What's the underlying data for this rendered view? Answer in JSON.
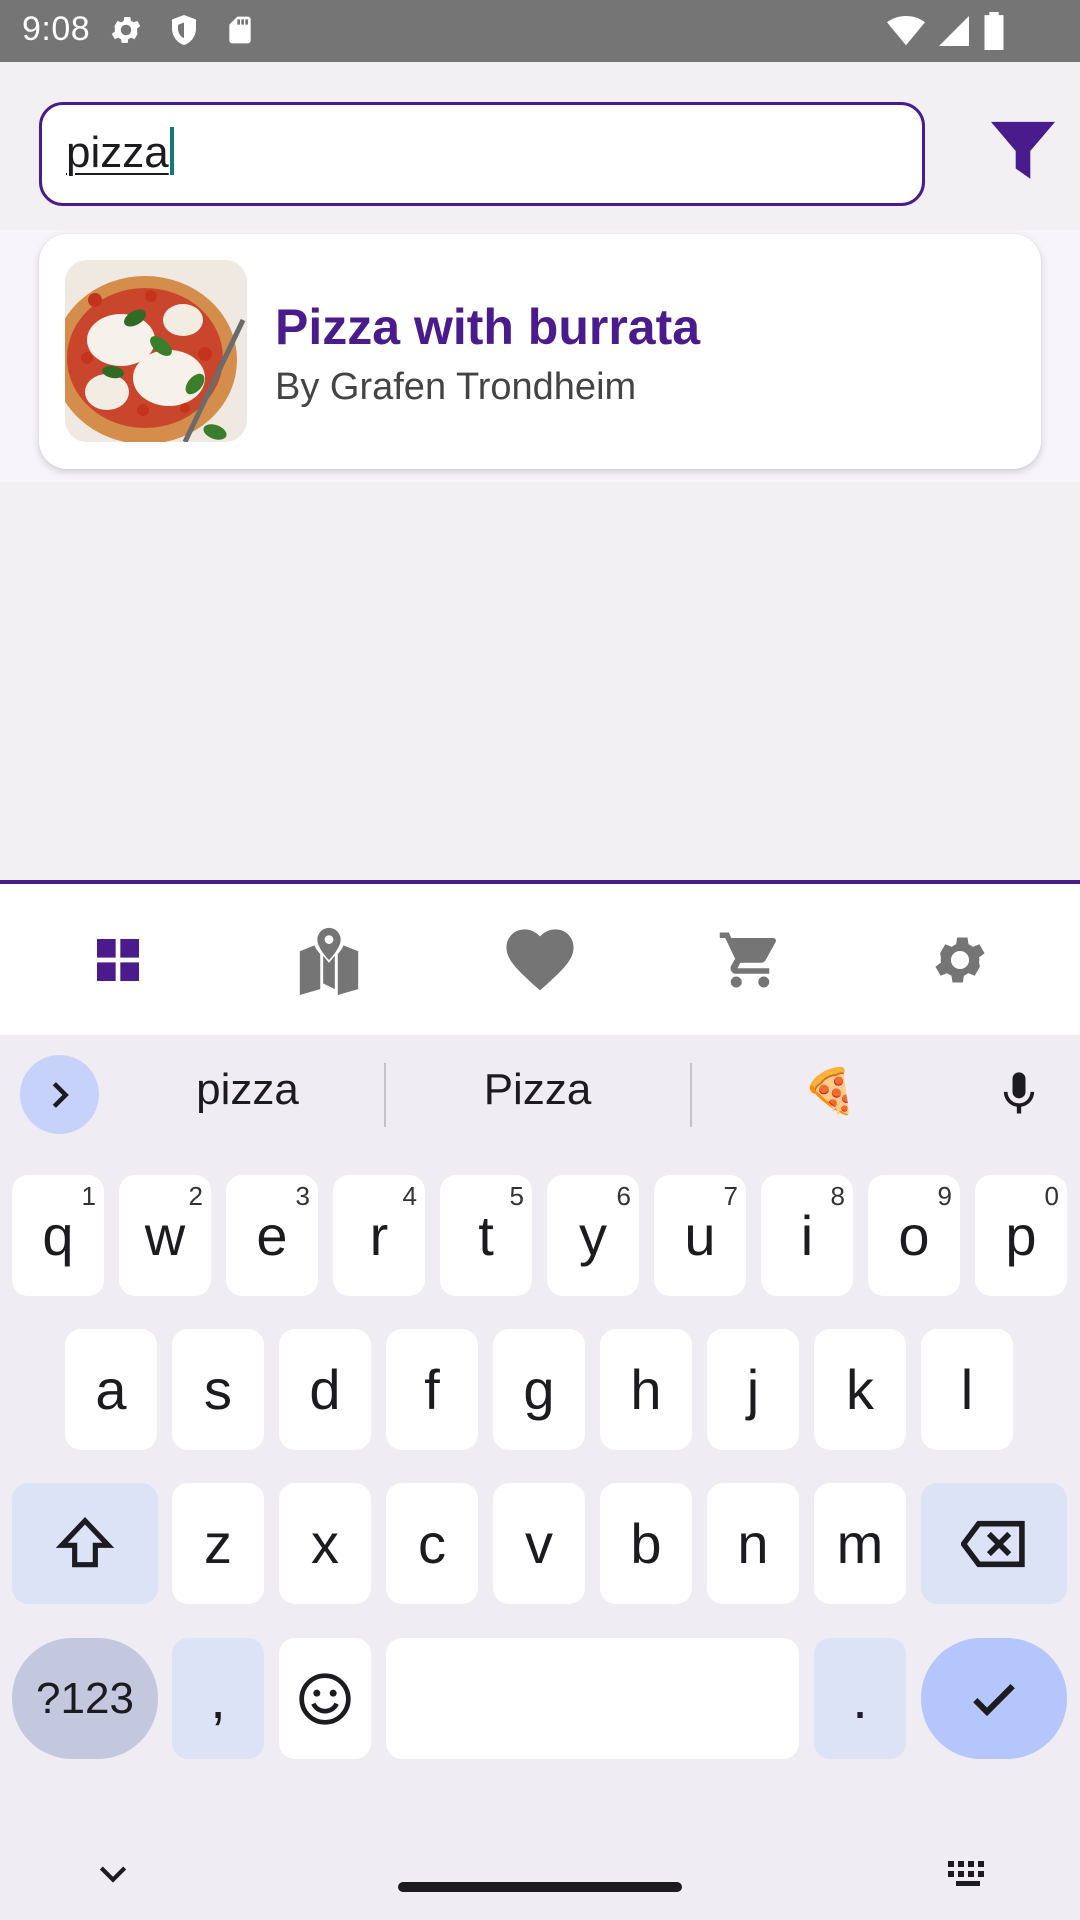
{
  "status_bar": {
    "time": "9:08",
    "icons": [
      "settings-icon",
      "shield-icon",
      "sd-card-icon",
      "wifi-icon",
      "signal-icon",
      "battery-icon"
    ]
  },
  "search": {
    "value": "pizza",
    "filter_icon": "filter-icon"
  },
  "results": [
    {
      "title": "Pizza with burrata",
      "subtitle": "By Grafen Trondheim"
    }
  ],
  "bottom_nav": {
    "items": [
      {
        "icon": "dashboard-icon",
        "active": true
      },
      {
        "icon": "map-icon",
        "active": false
      },
      {
        "icon": "heart-icon",
        "active": false
      },
      {
        "icon": "cart-icon",
        "active": false
      },
      {
        "icon": "gear-icon",
        "active": false
      }
    ]
  },
  "keyboard": {
    "suggestions": [
      "pizza",
      "Pizza",
      "🍕"
    ],
    "row1": [
      {
        "k": "q",
        "h": "1"
      },
      {
        "k": "w",
        "h": "2"
      },
      {
        "k": "e",
        "h": "3"
      },
      {
        "k": "r",
        "h": "4"
      },
      {
        "k": "t",
        "h": "5"
      },
      {
        "k": "y",
        "h": "6"
      },
      {
        "k": "u",
        "h": "7"
      },
      {
        "k": "i",
        "h": "8"
      },
      {
        "k": "o",
        "h": "9"
      },
      {
        "k": "p",
        "h": "0"
      }
    ],
    "row2": [
      "a",
      "s",
      "d",
      "f",
      "g",
      "h",
      "j",
      "k",
      "l"
    ],
    "row3": [
      "z",
      "x",
      "c",
      "v",
      "b",
      "n",
      "m"
    ],
    "symbols_label": "?123",
    "comma_label": ",",
    "period_label": "."
  },
  "colors": {
    "accent": "#4a1b8c",
    "nav_inactive": "#757575",
    "keyboard_accent": "#b4c6fb"
  }
}
